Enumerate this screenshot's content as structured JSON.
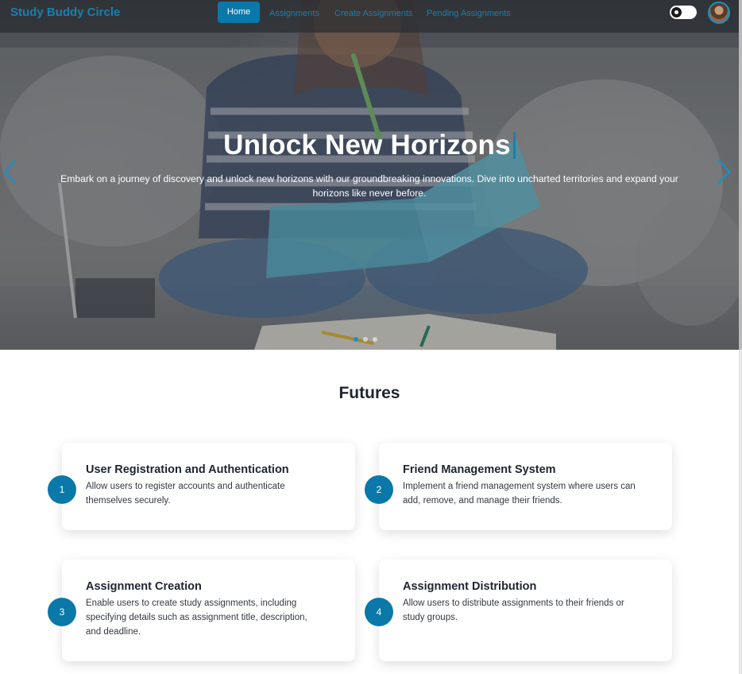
{
  "navbar": {
    "brand": "Study Buddy Circle",
    "links": [
      {
        "label": "Home",
        "active": true
      },
      {
        "label": "Assignments",
        "active": false
      },
      {
        "label": "Create Assignments",
        "active": false
      },
      {
        "label": "Pending Assignments",
        "active": false
      }
    ],
    "theme_toggle_icon": "toggle-icon",
    "avatar_icon": "user-avatar"
  },
  "hero": {
    "title": "Unlock New Horizons",
    "description": "Embark on a journey of discovery and unlock new horizons with our groundbreaking innovations. Dive into uncharted territories and expand your horizons like never before.",
    "prev_icon": "chevron-left-icon",
    "next_icon": "chevron-right-icon",
    "slides": 3,
    "active_slide": 1
  },
  "features": {
    "title": "Futures",
    "items": [
      {
        "number": "1",
        "title": "User Registration and Authentication",
        "description": "Allow users to register accounts and authenticate themselves securely."
      },
      {
        "number": "2",
        "title": "Friend Management System",
        "description": "Implement a friend management system where users can add, remove, and manage their friends."
      },
      {
        "number": "3",
        "title": "Assignment Creation",
        "description": "Enable users to create study assignments, including specifying details such as assignment title, description, and deadline."
      },
      {
        "number": "4",
        "title": "Assignment Distribution",
        "description": "Allow users to distribute assignments to their friends or study groups."
      }
    ]
  },
  "colors": {
    "accent": "#0a78a8",
    "brand": "#1b7fae",
    "text": "#1f2430"
  }
}
